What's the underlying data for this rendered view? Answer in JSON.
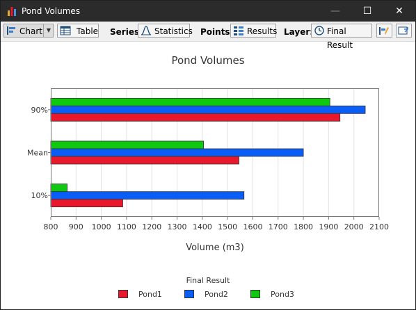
{
  "window": {
    "title": "Pond Volumes",
    "minimize": "—",
    "maximize": "☐",
    "close": "✕"
  },
  "toolbar": {
    "chart_label": "Chart",
    "table_label": "Table",
    "series_caption": "Series:",
    "series_value": "Statistics",
    "points_caption": "Points:",
    "points_value": "Results",
    "layer_caption": "Layer:",
    "layer_value": "Final Result"
  },
  "icons": [
    "app-chart-icon",
    "chart-icon",
    "dropdown-arrow-icon",
    "table-icon",
    "statistics-icon",
    "results-icon",
    "clock-icon",
    "properties-icon",
    "export-icon"
  ],
  "colors": {
    "pond1": "#e8192c",
    "pond2": "#0a5ef5",
    "pond3": "#11c811"
  },
  "chart_data": {
    "type": "bar",
    "orientation": "horizontal",
    "title": "Pond Volumes",
    "xlabel": "Volume (m3)",
    "ylabel": "",
    "categories": [
      "90%",
      "Mean",
      "10%"
    ],
    "series": [
      {
        "name": "Pond1",
        "values": [
          1945,
          1545,
          1085
        ]
      },
      {
        "name": "Pond2",
        "values": [
          2045,
          1800,
          1565
        ]
      },
      {
        "name": "Pond3",
        "values": [
          1905,
          1405,
          865
        ]
      }
    ],
    "xlim": [
      800,
      2100
    ],
    "xticks": [
      "800",
      "900",
      "1000",
      "1100",
      "1200",
      "1300",
      "1400",
      "1500",
      "1600",
      "1700",
      "1800",
      "1900",
      "2000",
      "2100"
    ],
    "grid": true,
    "legend": {
      "title": "Final Result",
      "placement": "bottom"
    }
  }
}
